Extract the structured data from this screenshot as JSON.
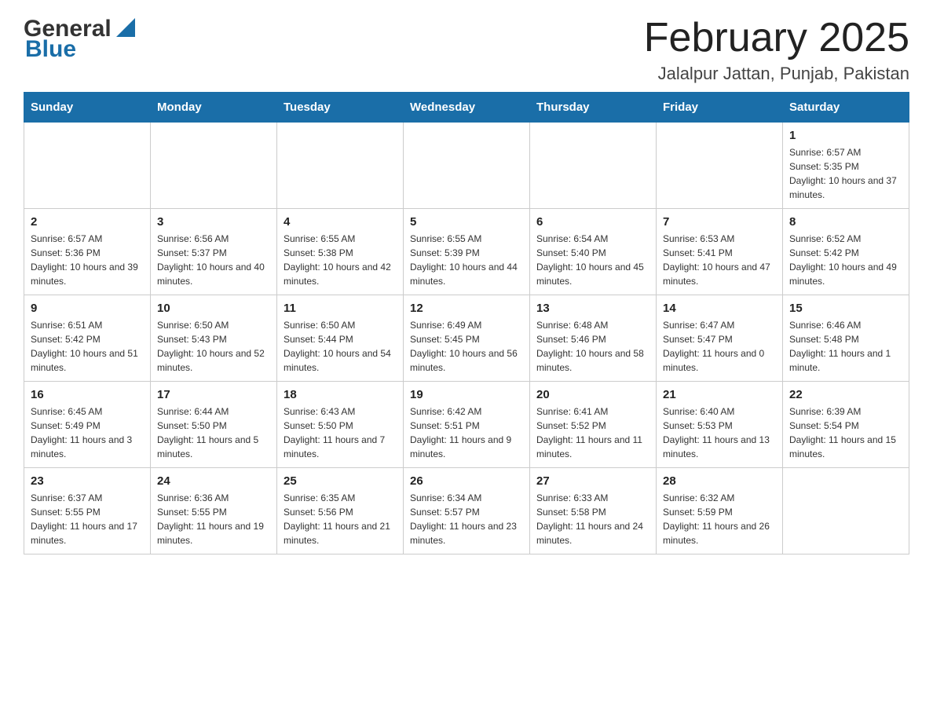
{
  "header": {
    "logo_general": "General",
    "logo_blue": "Blue",
    "title": "February 2025",
    "subtitle": "Jalalpur Jattan, Punjab, Pakistan"
  },
  "calendar": {
    "days_of_week": [
      "Sunday",
      "Monday",
      "Tuesday",
      "Wednesday",
      "Thursday",
      "Friday",
      "Saturday"
    ],
    "weeks": [
      [
        {
          "day": "",
          "info": ""
        },
        {
          "day": "",
          "info": ""
        },
        {
          "day": "",
          "info": ""
        },
        {
          "day": "",
          "info": ""
        },
        {
          "day": "",
          "info": ""
        },
        {
          "day": "",
          "info": ""
        },
        {
          "day": "1",
          "info": "Sunrise: 6:57 AM\nSunset: 5:35 PM\nDaylight: 10 hours and 37 minutes."
        }
      ],
      [
        {
          "day": "2",
          "info": "Sunrise: 6:57 AM\nSunset: 5:36 PM\nDaylight: 10 hours and 39 minutes."
        },
        {
          "day": "3",
          "info": "Sunrise: 6:56 AM\nSunset: 5:37 PM\nDaylight: 10 hours and 40 minutes."
        },
        {
          "day": "4",
          "info": "Sunrise: 6:55 AM\nSunset: 5:38 PM\nDaylight: 10 hours and 42 minutes."
        },
        {
          "day": "5",
          "info": "Sunrise: 6:55 AM\nSunset: 5:39 PM\nDaylight: 10 hours and 44 minutes."
        },
        {
          "day": "6",
          "info": "Sunrise: 6:54 AM\nSunset: 5:40 PM\nDaylight: 10 hours and 45 minutes."
        },
        {
          "day": "7",
          "info": "Sunrise: 6:53 AM\nSunset: 5:41 PM\nDaylight: 10 hours and 47 minutes."
        },
        {
          "day": "8",
          "info": "Sunrise: 6:52 AM\nSunset: 5:42 PM\nDaylight: 10 hours and 49 minutes."
        }
      ],
      [
        {
          "day": "9",
          "info": "Sunrise: 6:51 AM\nSunset: 5:42 PM\nDaylight: 10 hours and 51 minutes."
        },
        {
          "day": "10",
          "info": "Sunrise: 6:50 AM\nSunset: 5:43 PM\nDaylight: 10 hours and 52 minutes."
        },
        {
          "day": "11",
          "info": "Sunrise: 6:50 AM\nSunset: 5:44 PM\nDaylight: 10 hours and 54 minutes."
        },
        {
          "day": "12",
          "info": "Sunrise: 6:49 AM\nSunset: 5:45 PM\nDaylight: 10 hours and 56 minutes."
        },
        {
          "day": "13",
          "info": "Sunrise: 6:48 AM\nSunset: 5:46 PM\nDaylight: 10 hours and 58 minutes."
        },
        {
          "day": "14",
          "info": "Sunrise: 6:47 AM\nSunset: 5:47 PM\nDaylight: 11 hours and 0 minutes."
        },
        {
          "day": "15",
          "info": "Sunrise: 6:46 AM\nSunset: 5:48 PM\nDaylight: 11 hours and 1 minute."
        }
      ],
      [
        {
          "day": "16",
          "info": "Sunrise: 6:45 AM\nSunset: 5:49 PM\nDaylight: 11 hours and 3 minutes."
        },
        {
          "day": "17",
          "info": "Sunrise: 6:44 AM\nSunset: 5:50 PM\nDaylight: 11 hours and 5 minutes."
        },
        {
          "day": "18",
          "info": "Sunrise: 6:43 AM\nSunset: 5:50 PM\nDaylight: 11 hours and 7 minutes."
        },
        {
          "day": "19",
          "info": "Sunrise: 6:42 AM\nSunset: 5:51 PM\nDaylight: 11 hours and 9 minutes."
        },
        {
          "day": "20",
          "info": "Sunrise: 6:41 AM\nSunset: 5:52 PM\nDaylight: 11 hours and 11 minutes."
        },
        {
          "day": "21",
          "info": "Sunrise: 6:40 AM\nSunset: 5:53 PM\nDaylight: 11 hours and 13 minutes."
        },
        {
          "day": "22",
          "info": "Sunrise: 6:39 AM\nSunset: 5:54 PM\nDaylight: 11 hours and 15 minutes."
        }
      ],
      [
        {
          "day": "23",
          "info": "Sunrise: 6:37 AM\nSunset: 5:55 PM\nDaylight: 11 hours and 17 minutes."
        },
        {
          "day": "24",
          "info": "Sunrise: 6:36 AM\nSunset: 5:55 PM\nDaylight: 11 hours and 19 minutes."
        },
        {
          "day": "25",
          "info": "Sunrise: 6:35 AM\nSunset: 5:56 PM\nDaylight: 11 hours and 21 minutes."
        },
        {
          "day": "26",
          "info": "Sunrise: 6:34 AM\nSunset: 5:57 PM\nDaylight: 11 hours and 23 minutes."
        },
        {
          "day": "27",
          "info": "Sunrise: 6:33 AM\nSunset: 5:58 PM\nDaylight: 11 hours and 24 minutes."
        },
        {
          "day": "28",
          "info": "Sunrise: 6:32 AM\nSunset: 5:59 PM\nDaylight: 11 hours and 26 minutes."
        },
        {
          "day": "",
          "info": ""
        }
      ]
    ]
  }
}
